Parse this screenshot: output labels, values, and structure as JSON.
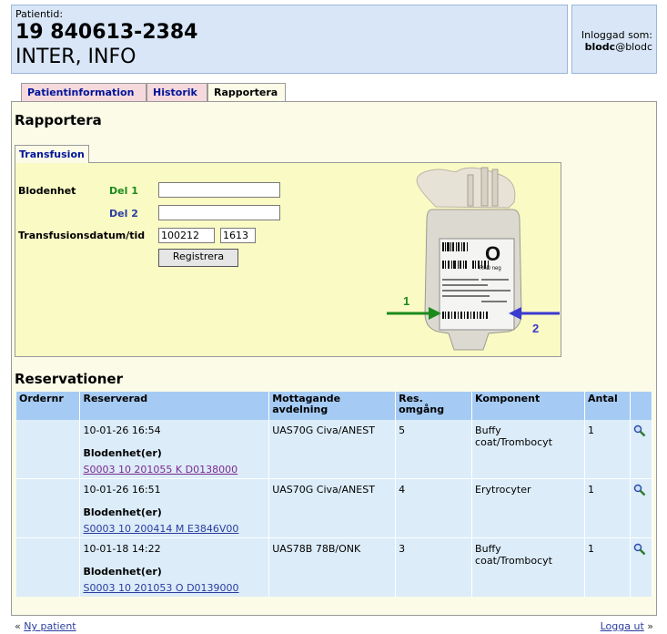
{
  "header": {
    "patient_label": "Patientid:",
    "patient_id": "19 840613-2384",
    "patient_name": "INTER, INFO"
  },
  "login": {
    "label": "Inloggad som:",
    "user_bold": "blodc",
    "user_rest": "@blodc"
  },
  "tabs": {
    "patientinfo": "Patientinformation",
    "historik": "Historik",
    "rapportera": "Rapportera"
  },
  "page_title": "Rapportera",
  "subtab": "Transfusion",
  "form": {
    "blodenhet_label": "Blodenhet",
    "del1_label": "Del 1",
    "del2_label": "Del 2",
    "datetime_label": "Transfusionsdatum/tid",
    "date_value": "100212",
    "time_value": "1613",
    "submit": "Registrera"
  },
  "bag": {
    "group": "O",
    "rh": "RhD neg",
    "arrow1": "1",
    "arrow2": "2",
    "colors": {
      "arrow1": "#1c8a1c",
      "arrow2": "#3a3ad0"
    }
  },
  "reservations": {
    "title": "Reservationer",
    "headers": {
      "ordernr": "Ordernr",
      "reserverad": "Reserverad",
      "mottagande_1": "Mottagande",
      "mottagande_2": "avdelning",
      "res_1": "Res.",
      "res_2": "omgång",
      "komponent": "Komponent",
      "antal": "Antal"
    },
    "blod_label": "Blodenhet(er)",
    "rows": [
      {
        "reserverad": "10-01-26 16:54",
        "avdelning": "UAS70G Civa/ANEST",
        "omgang": "5",
        "komponent": "Buffy coat/Trombocyt",
        "antal": "1",
        "blodenhet": "S0003 10 201055 K D0138000"
      },
      {
        "reserverad": "10-01-26 16:51",
        "avdelning": "UAS70G Civa/ANEST",
        "omgang": "4",
        "komponent": "Erytrocyter",
        "antal": "1",
        "blodenhet": "S0003 10 200414 M E3846V00"
      },
      {
        "reserverad": "10-01-18 14:22",
        "avdelning": "UAS78B 78B/ONK",
        "omgang": "3",
        "komponent": "Buffy coat/Trombocyt",
        "antal": "1",
        "blodenhet": "S0003 10 201053 O D0139000"
      }
    ]
  },
  "footer": {
    "left_prefix": "«",
    "new_patient": "Ny patient",
    "logout": "Logga ut",
    "right_suffix": "»"
  }
}
